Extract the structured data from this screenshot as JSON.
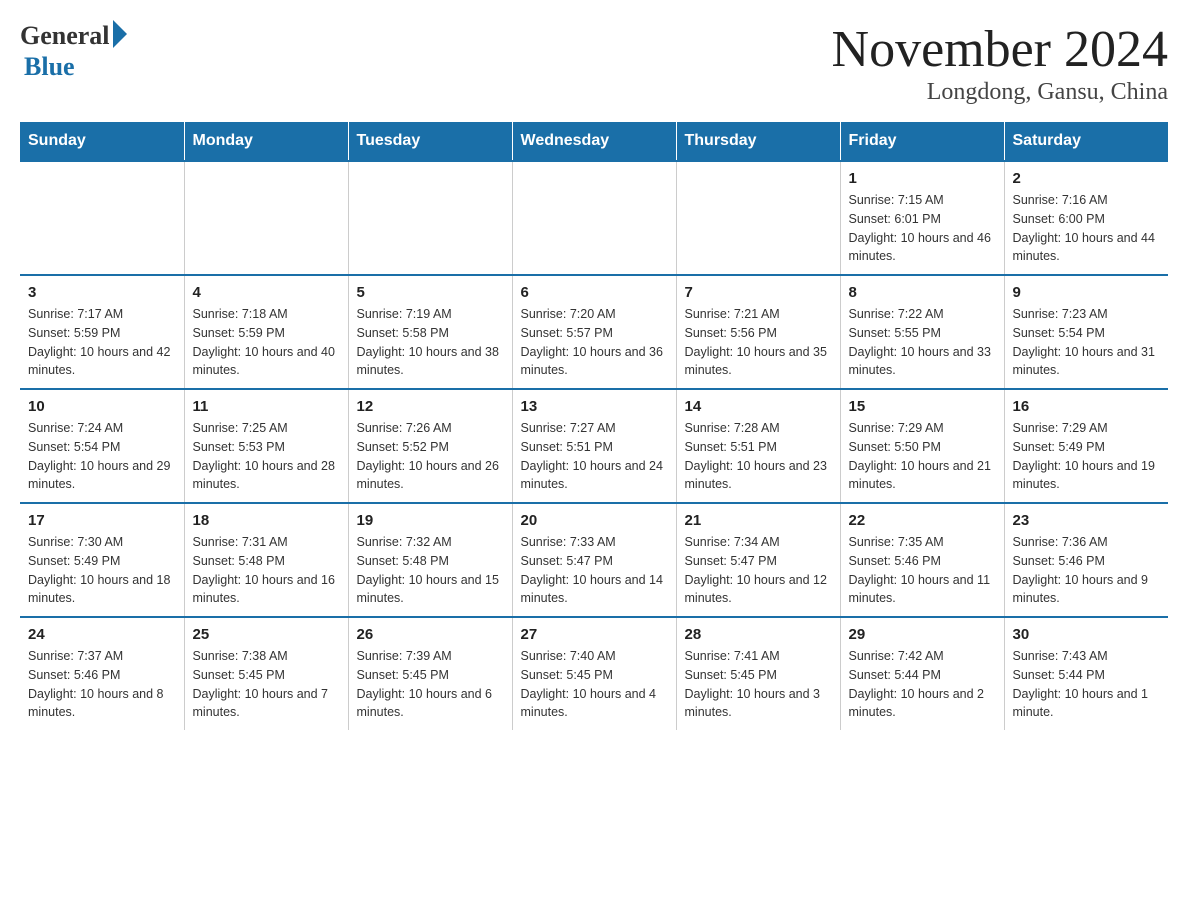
{
  "logo": {
    "general": "General",
    "blue": "Blue"
  },
  "title": "November 2024",
  "subtitle": "Longdong, Gansu, China",
  "days_of_week": [
    "Sunday",
    "Monday",
    "Tuesday",
    "Wednesday",
    "Thursday",
    "Friday",
    "Saturday"
  ],
  "weeks": [
    [
      {
        "day": "",
        "info": ""
      },
      {
        "day": "",
        "info": ""
      },
      {
        "day": "",
        "info": ""
      },
      {
        "day": "",
        "info": ""
      },
      {
        "day": "",
        "info": ""
      },
      {
        "day": "1",
        "info": "Sunrise: 7:15 AM\nSunset: 6:01 PM\nDaylight: 10 hours and 46 minutes."
      },
      {
        "day": "2",
        "info": "Sunrise: 7:16 AM\nSunset: 6:00 PM\nDaylight: 10 hours and 44 minutes."
      }
    ],
    [
      {
        "day": "3",
        "info": "Sunrise: 7:17 AM\nSunset: 5:59 PM\nDaylight: 10 hours and 42 minutes."
      },
      {
        "day": "4",
        "info": "Sunrise: 7:18 AM\nSunset: 5:59 PM\nDaylight: 10 hours and 40 minutes."
      },
      {
        "day": "5",
        "info": "Sunrise: 7:19 AM\nSunset: 5:58 PM\nDaylight: 10 hours and 38 minutes."
      },
      {
        "day": "6",
        "info": "Sunrise: 7:20 AM\nSunset: 5:57 PM\nDaylight: 10 hours and 36 minutes."
      },
      {
        "day": "7",
        "info": "Sunrise: 7:21 AM\nSunset: 5:56 PM\nDaylight: 10 hours and 35 minutes."
      },
      {
        "day": "8",
        "info": "Sunrise: 7:22 AM\nSunset: 5:55 PM\nDaylight: 10 hours and 33 minutes."
      },
      {
        "day": "9",
        "info": "Sunrise: 7:23 AM\nSunset: 5:54 PM\nDaylight: 10 hours and 31 minutes."
      }
    ],
    [
      {
        "day": "10",
        "info": "Sunrise: 7:24 AM\nSunset: 5:54 PM\nDaylight: 10 hours and 29 minutes."
      },
      {
        "day": "11",
        "info": "Sunrise: 7:25 AM\nSunset: 5:53 PM\nDaylight: 10 hours and 28 minutes."
      },
      {
        "day": "12",
        "info": "Sunrise: 7:26 AM\nSunset: 5:52 PM\nDaylight: 10 hours and 26 minutes."
      },
      {
        "day": "13",
        "info": "Sunrise: 7:27 AM\nSunset: 5:51 PM\nDaylight: 10 hours and 24 minutes."
      },
      {
        "day": "14",
        "info": "Sunrise: 7:28 AM\nSunset: 5:51 PM\nDaylight: 10 hours and 23 minutes."
      },
      {
        "day": "15",
        "info": "Sunrise: 7:29 AM\nSunset: 5:50 PM\nDaylight: 10 hours and 21 minutes."
      },
      {
        "day": "16",
        "info": "Sunrise: 7:29 AM\nSunset: 5:49 PM\nDaylight: 10 hours and 19 minutes."
      }
    ],
    [
      {
        "day": "17",
        "info": "Sunrise: 7:30 AM\nSunset: 5:49 PM\nDaylight: 10 hours and 18 minutes."
      },
      {
        "day": "18",
        "info": "Sunrise: 7:31 AM\nSunset: 5:48 PM\nDaylight: 10 hours and 16 minutes."
      },
      {
        "day": "19",
        "info": "Sunrise: 7:32 AM\nSunset: 5:48 PM\nDaylight: 10 hours and 15 minutes."
      },
      {
        "day": "20",
        "info": "Sunrise: 7:33 AM\nSunset: 5:47 PM\nDaylight: 10 hours and 14 minutes."
      },
      {
        "day": "21",
        "info": "Sunrise: 7:34 AM\nSunset: 5:47 PM\nDaylight: 10 hours and 12 minutes."
      },
      {
        "day": "22",
        "info": "Sunrise: 7:35 AM\nSunset: 5:46 PM\nDaylight: 10 hours and 11 minutes."
      },
      {
        "day": "23",
        "info": "Sunrise: 7:36 AM\nSunset: 5:46 PM\nDaylight: 10 hours and 9 minutes."
      }
    ],
    [
      {
        "day": "24",
        "info": "Sunrise: 7:37 AM\nSunset: 5:46 PM\nDaylight: 10 hours and 8 minutes."
      },
      {
        "day": "25",
        "info": "Sunrise: 7:38 AM\nSunset: 5:45 PM\nDaylight: 10 hours and 7 minutes."
      },
      {
        "day": "26",
        "info": "Sunrise: 7:39 AM\nSunset: 5:45 PM\nDaylight: 10 hours and 6 minutes."
      },
      {
        "day": "27",
        "info": "Sunrise: 7:40 AM\nSunset: 5:45 PM\nDaylight: 10 hours and 4 minutes."
      },
      {
        "day": "28",
        "info": "Sunrise: 7:41 AM\nSunset: 5:45 PM\nDaylight: 10 hours and 3 minutes."
      },
      {
        "day": "29",
        "info": "Sunrise: 7:42 AM\nSunset: 5:44 PM\nDaylight: 10 hours and 2 minutes."
      },
      {
        "day": "30",
        "info": "Sunrise: 7:43 AM\nSunset: 5:44 PM\nDaylight: 10 hours and 1 minute."
      }
    ]
  ]
}
